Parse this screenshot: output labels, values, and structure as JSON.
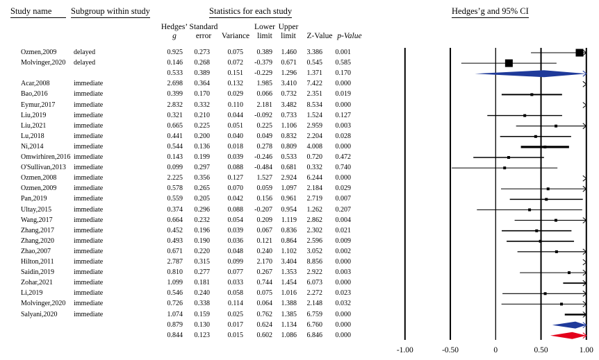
{
  "headers": {
    "study_name": "Study name",
    "subgroup": "Subgroup within study",
    "statistics": "Statistics for each study",
    "plot_title": "Hedges’g and 95% CI",
    "columns": [
      {
        "line1": "Hedges’",
        "line2": "g"
      },
      {
        "line1": "Standard",
        "line2": "error"
      },
      {
        "line1": "",
        "line2": "Variance"
      },
      {
        "line1": "Lower",
        "line2": "limit"
      },
      {
        "line1": "Upper",
        "line2": "limit"
      },
      {
        "line1": "",
        "line2": "Z-Value"
      },
      {
        "line1": "",
        "line2": "p-Value"
      }
    ]
  },
  "chart_data": {
    "type": "forest",
    "title": "Hedges’g and 95% CI",
    "xlim": [
      -1.0,
      1.0
    ],
    "xticks": [
      "-1.00",
      "-0.50",
      "0",
      "0.50",
      "1.00"
    ],
    "xtick_values": [
      -1.0,
      -0.5,
      0,
      0.5,
      1.0
    ],
    "colors": {
      "study": "#000000",
      "subgroup_summary": "#1f3a9a",
      "overall_summary": "#e3001b"
    },
    "rows": [
      {
        "study": "Ozmen,2009",
        "subgroup": "delayed",
        "g": "0.925",
        "se": "0.273",
        "var": "0.075",
        "lower": "0.389",
        "upper": "1.460",
        "z": "3.386",
        "p": "0.001",
        "kind": "study-big"
      },
      {
        "study": "Molvinger,2020",
        "subgroup": "delayed",
        "g": "0.146",
        "se": "0.268",
        "var": "0.072",
        "lower": "-0.379",
        "upper": "0.671",
        "z": "0.545",
        "p": "0.585",
        "kind": "study-big"
      },
      {
        "study": "",
        "subgroup": "",
        "g": "0.533",
        "se": "0.389",
        "var": "0.151",
        "lower": "-0.229",
        "upper": "1.296",
        "z": "1.371",
        "p": "0.170",
        "kind": "subgroup"
      },
      {
        "study": "Acar,2008",
        "subgroup": "immediate",
        "g": "2.698",
        "se": "0.364",
        "var": "0.132",
        "lower": "1.985",
        "upper": "3.410",
        "z": "7.422",
        "p": "0.000",
        "kind": "study"
      },
      {
        "study": "Bao,2016",
        "subgroup": "immediate",
        "g": "0.399",
        "se": "0.170",
        "var": "0.029",
        "lower": "0.066",
        "upper": "0.732",
        "z": "2.351",
        "p": "0.019",
        "kind": "study"
      },
      {
        "study": "Eymur,2017",
        "subgroup": "immediate",
        "g": "2.832",
        "se": "0.332",
        "var": "0.110",
        "lower": "2.181",
        "upper": "3.482",
        "z": "8.534",
        "p": "0.000",
        "kind": "study"
      },
      {
        "study": "Liu,2019",
        "subgroup": "immediate",
        "g": "0.321",
        "se": "0.210",
        "var": "0.044",
        "lower": "-0.092",
        "upper": "0.733",
        "z": "1.524",
        "p": "0.127",
        "kind": "study"
      },
      {
        "study": "Liu,2021",
        "subgroup": "immediate",
        "g": "0.665",
        "se": "0.225",
        "var": "0.051",
        "lower": "0.225",
        "upper": "1.106",
        "z": "2.959",
        "p": "0.003",
        "kind": "study"
      },
      {
        "study": "Lu,2018",
        "subgroup": "immediate",
        "g": "0.441",
        "se": "0.200",
        "var": "0.040",
        "lower": "0.049",
        "upper": "0.832",
        "z": "2.204",
        "p": "0.028",
        "kind": "study"
      },
      {
        "study": "Ni,2014",
        "subgroup": "immediate",
        "g": "0.544",
        "se": "0.136",
        "var": "0.018",
        "lower": "0.278",
        "upper": "0.809",
        "z": "4.008",
        "p": "0.000",
        "kind": "study"
      },
      {
        "study": "Omwirhiren,2016",
        "subgroup": "immediate",
        "g": "0.143",
        "se": "0.199",
        "var": "0.039",
        "lower": "-0.246",
        "upper": "0.533",
        "z": "0.720",
        "p": "0.472",
        "kind": "study"
      },
      {
        "study": "O'Sullivan,2013",
        "subgroup": "immediate",
        "g": "0.099",
        "se": "0.297",
        "var": "0.088",
        "lower": "-0.484",
        "upper": "0.681",
        "z": "0.332",
        "p": "0.740",
        "kind": "study"
      },
      {
        "study": "Ozmen,2008",
        "subgroup": "immediate",
        "g": "2.225",
        "se": "0.356",
        "var": "0.127",
        "lower": "1.527",
        "upper": "2.924",
        "z": "6.244",
        "p": "0.000",
        "kind": "study"
      },
      {
        "study": "Ozmen,2009",
        "subgroup": "immediate",
        "g": "0.578",
        "se": "0.265",
        "var": "0.070",
        "lower": "0.059",
        "upper": "1.097",
        "z": "2.184",
        "p": "0.029",
        "kind": "study"
      },
      {
        "study": "Pan,2019",
        "subgroup": "immediate",
        "g": "0.559",
        "se": "0.205",
        "var": "0.042",
        "lower": "0.156",
        "upper": "0.961",
        "z": "2.719",
        "p": "0.007",
        "kind": "study"
      },
      {
        "study": "Ultay,2015",
        "subgroup": "immediate",
        "g": "0.374",
        "se": "0.296",
        "var": "0.088",
        "lower": "-0.207",
        "upper": "0.954",
        "z": "1.262",
        "p": "0.207",
        "kind": "study"
      },
      {
        "study": "Wang,2017",
        "subgroup": "immediate",
        "g": "0.664",
        "se": "0.232",
        "var": "0.054",
        "lower": "0.209",
        "upper": "1.119",
        "z": "2.862",
        "p": "0.004",
        "kind": "study"
      },
      {
        "study": "Zhang,2017",
        "subgroup": "immediate",
        "g": "0.452",
        "se": "0.196",
        "var": "0.039",
        "lower": "0.067",
        "upper": "0.836",
        "z": "2.302",
        "p": "0.021",
        "kind": "study"
      },
      {
        "study": "Zhang,2020",
        "subgroup": "immediate",
        "g": "0.493",
        "se": "0.190",
        "var": "0.036",
        "lower": "0.121",
        "upper": "0.864",
        "z": "2.596",
        "p": "0.009",
        "kind": "study"
      },
      {
        "study": "Zhao,2007",
        "subgroup": "immediate",
        "g": "0.671",
        "se": "0.220",
        "var": "0.048",
        "lower": "0.240",
        "upper": "1.102",
        "z": "3.052",
        "p": "0.002",
        "kind": "study"
      },
      {
        "study": "Hilton,2011",
        "subgroup": "immediate",
        "g": "2.787",
        "se": "0.315",
        "var": "0.099",
        "lower": "2.170",
        "upper": "3.404",
        "z": "8.856",
        "p": "0.000",
        "kind": "study"
      },
      {
        "study": "Saidin,2019",
        "subgroup": "immediate",
        "g": "0.810",
        "se": "0.277",
        "var": "0.077",
        "lower": "0.267",
        "upper": "1.353",
        "z": "2.922",
        "p": "0.003",
        "kind": "study"
      },
      {
        "study": "Zohar,2021",
        "subgroup": "immediate",
        "g": "1.099",
        "se": "0.181",
        "var": "0.033",
        "lower": "0.744",
        "upper": "1.454",
        "z": "6.073",
        "p": "0.000",
        "kind": "study"
      },
      {
        "study": "Li,2019",
        "subgroup": "immediate",
        "g": "0.546",
        "se": "0.240",
        "var": "0.058",
        "lower": "0.075",
        "upper": "1.016",
        "z": "2.272",
        "p": "0.023",
        "kind": "study"
      },
      {
        "study": "Molvinger,2020",
        "subgroup": "immediate",
        "g": "0.726",
        "se": "0.338",
        "var": "0.114",
        "lower": "0.064",
        "upper": "1.388",
        "z": "2.148",
        "p": "0.032",
        "kind": "study"
      },
      {
        "study": "Salyani,2020",
        "subgroup": "immediate",
        "g": "1.074",
        "se": "0.159",
        "var": "0.025",
        "lower": "0.762",
        "upper": "1.385",
        "z": "6.759",
        "p": "0.000",
        "kind": "study"
      },
      {
        "study": "",
        "subgroup": "",
        "g": "0.879",
        "se": "0.130",
        "var": "0.017",
        "lower": "0.624",
        "upper": "1.134",
        "z": "6.760",
        "p": "0.000",
        "kind": "subgroup"
      },
      {
        "study": "",
        "subgroup": "",
        "g": "0.844",
        "se": "0.123",
        "var": "0.015",
        "lower": "0.602",
        "upper": "1.086",
        "z": "6.846",
        "p": "0.000",
        "kind": "overall"
      }
    ]
  }
}
